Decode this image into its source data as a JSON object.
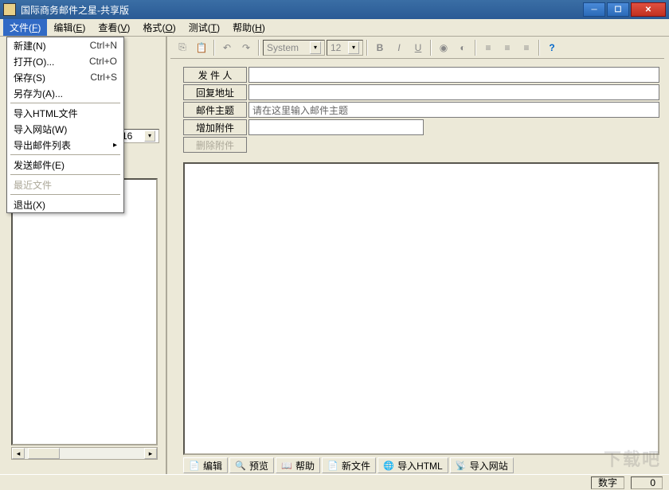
{
  "window": {
    "title": "国际商务邮件之星-共享版"
  },
  "menubar": [
    {
      "label": "文件",
      "hotkey": "F",
      "active": true
    },
    {
      "label": "编辑",
      "hotkey": "E"
    },
    {
      "label": "查看",
      "hotkey": "V"
    },
    {
      "label": "格式",
      "hotkey": "O"
    },
    {
      "label": "测试",
      "hotkey": "T"
    },
    {
      "label": "帮助",
      "hotkey": "H"
    }
  ],
  "filemenu": [
    {
      "label": "新建(N)",
      "shortcut": "Ctrl+N"
    },
    {
      "label": "打开(O)...",
      "shortcut": "Ctrl+O"
    },
    {
      "label": "保存(S)",
      "shortcut": "Ctrl+S"
    },
    {
      "label": "另存为(A)...",
      "shortcut": ""
    },
    {
      "sep": true
    },
    {
      "label": "导入HTML文件",
      "shortcut": ""
    },
    {
      "label": "导入网站(W)",
      "shortcut": ""
    },
    {
      "label": "导出邮件列表",
      "shortcut": "",
      "arrow": true
    },
    {
      "sep": true
    },
    {
      "label": "发送邮件(E)",
      "shortcut": ""
    },
    {
      "sep": true
    },
    {
      "label": "最近文件",
      "shortcut": "",
      "disabled": true
    },
    {
      "sep": true
    },
    {
      "label": "退出(X)",
      "shortcut": ""
    }
  ],
  "toolbar": {
    "font_name": "System",
    "font_size": "12",
    "buttons": {
      "copy": "⎘",
      "paste": "📋",
      "undo": "↶",
      "redo": "↷",
      "bold": "B",
      "italic": "I",
      "underline": "U",
      "color": "◉",
      "bgcolor": "◐",
      "left": "≡",
      "center": "≡",
      "right": "≡",
      "help": "?"
    }
  },
  "left": {
    "fontsize": "16"
  },
  "form": {
    "sender": {
      "label": "发 件 人",
      "value": ""
    },
    "reply": {
      "label": "回复地址",
      "value": ""
    },
    "subject": {
      "label": "邮件主题",
      "value": "请在这里输入邮件主题"
    },
    "add_attach": {
      "label": "增加附件"
    },
    "del_attach": {
      "label": "删除附件"
    }
  },
  "tabs": [
    {
      "icon": "📄",
      "label": "编辑"
    },
    {
      "icon": "🔍",
      "label": "预览"
    },
    {
      "icon": "📖",
      "label": "帮助"
    },
    {
      "icon": "📄",
      "label": "新文件"
    },
    {
      "icon": "🌐",
      "label": "导入HTML"
    },
    {
      "icon": "📡",
      "label": "导入网站"
    }
  ],
  "status": {
    "label": "数字",
    "value": "0"
  },
  "watermark": "下载吧"
}
